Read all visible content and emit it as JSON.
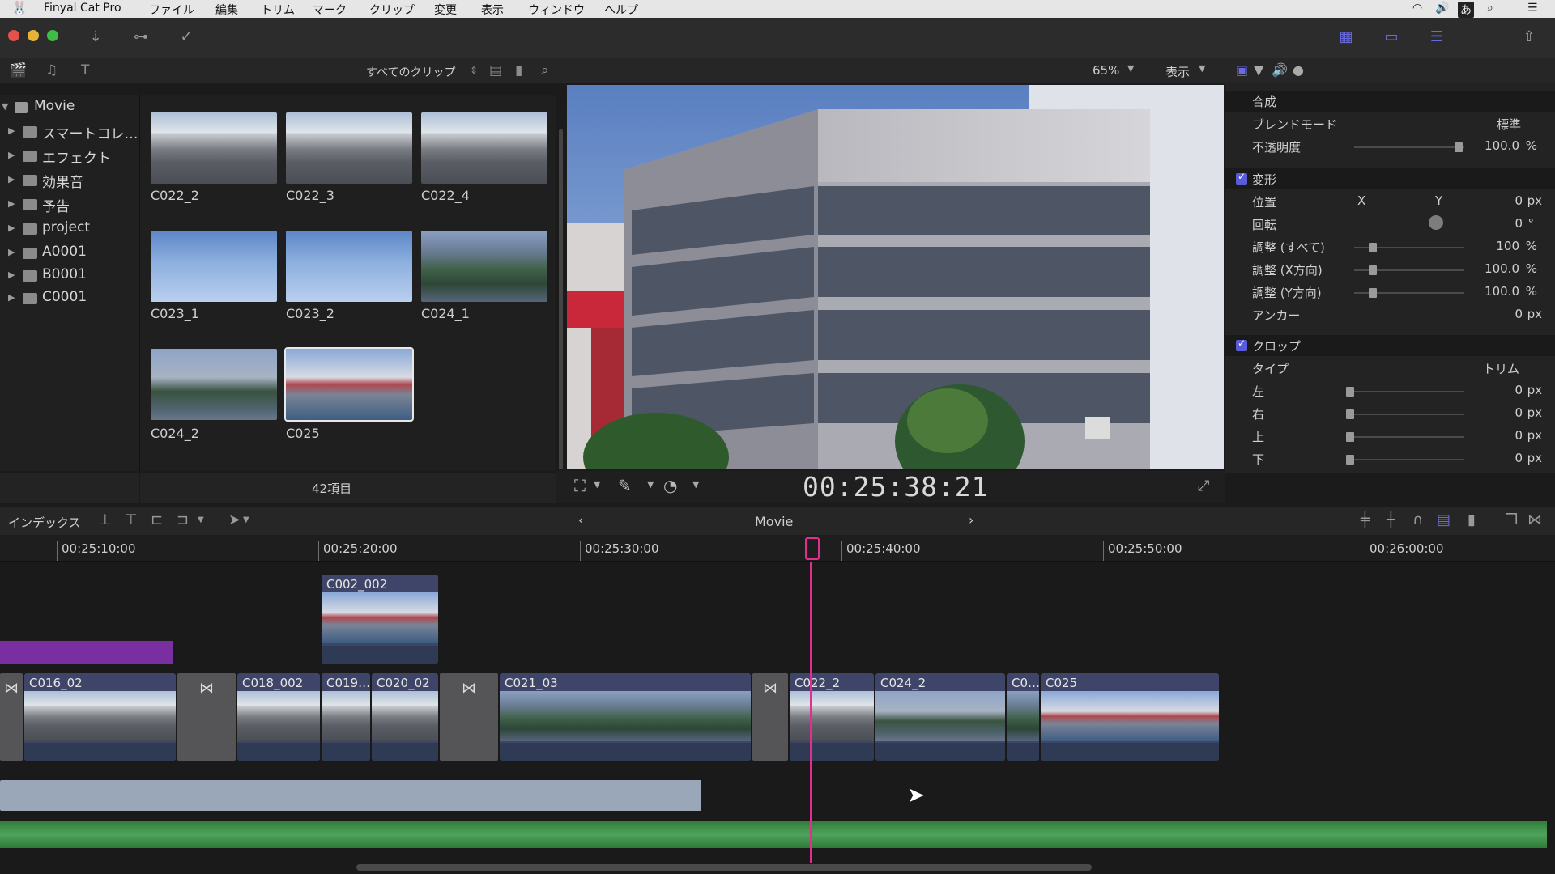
{
  "menubar": {
    "app_name": "Finyal Cat Pro",
    "items": [
      "ファイル",
      "編集",
      "トリム",
      "マーク",
      "クリップ",
      "変更",
      "表示",
      "ウィンドウ",
      "ヘルプ"
    ]
  },
  "browser": {
    "filter": "すべてのクリップ",
    "count": "42項目",
    "clips": [
      "C022_2",
      "C022_3",
      "C022_4",
      "C023_1",
      "C023_2",
      "C024_1",
      "C024_2",
      "C025"
    ]
  },
  "library": {
    "root": "Movie",
    "items": [
      "スマートコレ…",
      "エフェクト",
      "効果音",
      "予告",
      "project",
      "A0001",
      "B0001",
      "C0001"
    ]
  },
  "viewer": {
    "zoom": "65%",
    "view_label": "表示",
    "timecode": "00:25:38:21"
  },
  "inspector": {
    "composite": {
      "title": "合成",
      "blend_label": "ブレンドモード",
      "blend_value": "標準",
      "opacity_label": "不透明度",
      "opacity_value": "100.0",
      "opacity_unit": "%"
    },
    "transform": {
      "title": "変形",
      "pos_label": "位置",
      "x": "X",
      "y": "Y",
      "pos_value": "0",
      "pos_unit": "px",
      "rot_label": "回転",
      "rot_value": "0",
      "rot_unit": "°",
      "scale_all_label": "調整 (すべて)",
      "scale_all_value": "100",
      "scale_all_unit": "%",
      "scale_x_label": "調整 (X方向)",
      "scale_x_value": "100.0",
      "scale_x_unit": "%",
      "scale_y_label": "調整 (Y方向)",
      "scale_y_value": "100.0",
      "scale_y_unit": "%",
      "anchor_label": "アンカー",
      "anchor_value": "0",
      "anchor_unit": "px"
    },
    "crop": {
      "title": "クロップ",
      "type_label": "タイプ",
      "type_value": "トリム",
      "left_label": "左",
      "right_label": "右",
      "top_label": "上",
      "bottom_label": "下",
      "value": "0",
      "unit": "px"
    }
  },
  "timeline": {
    "index_label": "インデックス",
    "project_name": "Movie",
    "ruler": [
      "00:25:10:00",
      "00:25:20:00",
      "00:25:30:00",
      "00:25:40:00",
      "00:25:50:00",
      "00:26:00:00"
    ],
    "connected_clip": "C002_002",
    "clips": [
      "C016_02",
      "C018_002",
      "C019…",
      "C020_02",
      "C021_03",
      "C022_2",
      "C024_2",
      "C0…",
      "C025"
    ]
  },
  "colors": {
    "accent": "#5a5bd8",
    "playhead": "#e0308f",
    "clip": "#3e4569",
    "audio": "#2f7a3a",
    "title_clip": "#7a2fa0"
  }
}
